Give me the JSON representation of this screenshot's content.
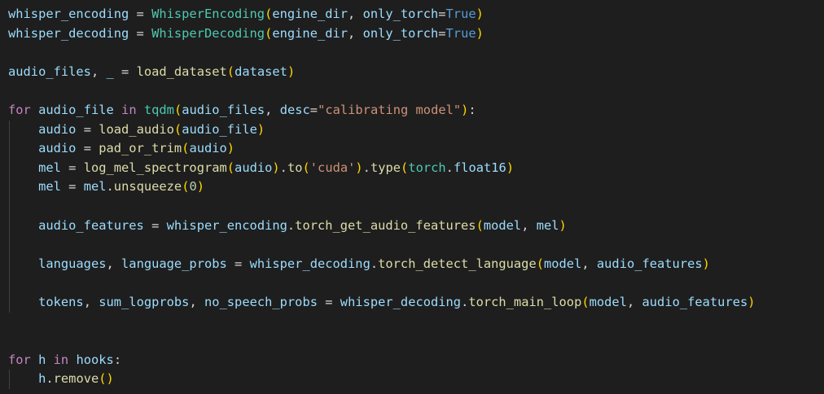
{
  "editor": {
    "colors": {
      "background": "#1e1e1e",
      "variable": "#9cdcfe",
      "function": "#dcdcaa",
      "class": "#4ec9b0",
      "keyword": "#c586c0",
      "string": "#ce9178",
      "number": "#b5cea8",
      "constant": "#569cd6",
      "punctuation": "#d4d4d4",
      "bracket_1": "#ffd700",
      "bracket_2": "#da70d6"
    },
    "lines": [
      {
        "indent": 0,
        "tokens": [
          {
            "t": "whisper_encoding",
            "c": "variable"
          },
          {
            "t": " = ",
            "c": "punctuation"
          },
          {
            "t": "WhisperEncoding",
            "c": "class"
          },
          {
            "t": "(",
            "c": "bracket_1"
          },
          {
            "t": "engine_dir",
            "c": "variable"
          },
          {
            "t": ", ",
            "c": "punctuation"
          },
          {
            "t": "only_torch",
            "c": "variable"
          },
          {
            "t": "=",
            "c": "punctuation"
          },
          {
            "t": "True",
            "c": "constant"
          },
          {
            "t": ")",
            "c": "bracket_1"
          }
        ]
      },
      {
        "indent": 0,
        "tokens": [
          {
            "t": "whisper_decoding",
            "c": "variable"
          },
          {
            "t": " = ",
            "c": "punctuation"
          },
          {
            "t": "WhisperDecoding",
            "c": "class"
          },
          {
            "t": "(",
            "c": "bracket_1"
          },
          {
            "t": "engine_dir",
            "c": "variable"
          },
          {
            "t": ", ",
            "c": "punctuation"
          },
          {
            "t": "only_torch",
            "c": "variable"
          },
          {
            "t": "=",
            "c": "punctuation"
          },
          {
            "t": "True",
            "c": "constant"
          },
          {
            "t": ")",
            "c": "bracket_1"
          }
        ]
      },
      {
        "indent": 0,
        "tokens": []
      },
      {
        "indent": 0,
        "tokens": [
          {
            "t": "audio_files",
            "c": "variable"
          },
          {
            "t": ", ",
            "c": "punctuation"
          },
          {
            "t": "_",
            "c": "variable"
          },
          {
            "t": " = ",
            "c": "punctuation"
          },
          {
            "t": "load_dataset",
            "c": "function"
          },
          {
            "t": "(",
            "c": "bracket_1"
          },
          {
            "t": "dataset",
            "c": "variable"
          },
          {
            "t": ")",
            "c": "bracket_1"
          }
        ]
      },
      {
        "indent": 0,
        "tokens": []
      },
      {
        "indent": 0,
        "tokens": [
          {
            "t": "for",
            "c": "keyword"
          },
          {
            "t": " ",
            "c": "punctuation"
          },
          {
            "t": "audio_file",
            "c": "variable"
          },
          {
            "t": " ",
            "c": "punctuation"
          },
          {
            "t": "in",
            "c": "keyword"
          },
          {
            "t": " ",
            "c": "punctuation"
          },
          {
            "t": "tqdm",
            "c": "class"
          },
          {
            "t": "(",
            "c": "bracket_1"
          },
          {
            "t": "audio_files",
            "c": "variable"
          },
          {
            "t": ", ",
            "c": "punctuation"
          },
          {
            "t": "desc",
            "c": "variable"
          },
          {
            "t": "=",
            "c": "punctuation"
          },
          {
            "t": "\"calibrating model\"",
            "c": "string"
          },
          {
            "t": ")",
            "c": "bracket_1"
          },
          {
            "t": ":",
            "c": "punctuation"
          }
        ]
      },
      {
        "indent": 1,
        "tokens": [
          {
            "t": "audio",
            "c": "variable"
          },
          {
            "t": " = ",
            "c": "punctuation"
          },
          {
            "t": "load_audio",
            "c": "function"
          },
          {
            "t": "(",
            "c": "bracket_1"
          },
          {
            "t": "audio_file",
            "c": "variable"
          },
          {
            "t": ")",
            "c": "bracket_1"
          }
        ]
      },
      {
        "indent": 1,
        "tokens": [
          {
            "t": "audio",
            "c": "variable"
          },
          {
            "t": " = ",
            "c": "punctuation"
          },
          {
            "t": "pad_or_trim",
            "c": "function"
          },
          {
            "t": "(",
            "c": "bracket_1"
          },
          {
            "t": "audio",
            "c": "variable"
          },
          {
            "t": ")",
            "c": "bracket_1"
          }
        ]
      },
      {
        "indent": 1,
        "tokens": [
          {
            "t": "mel",
            "c": "variable"
          },
          {
            "t": " = ",
            "c": "punctuation"
          },
          {
            "t": "log_mel_spectrogram",
            "c": "function"
          },
          {
            "t": "(",
            "c": "bracket_1"
          },
          {
            "t": "audio",
            "c": "variable"
          },
          {
            "t": ")",
            "c": "bracket_1"
          },
          {
            "t": ".",
            "c": "punctuation"
          },
          {
            "t": "to",
            "c": "function"
          },
          {
            "t": "(",
            "c": "bracket_1"
          },
          {
            "t": "'cuda'",
            "c": "string"
          },
          {
            "t": ")",
            "c": "bracket_1"
          },
          {
            "t": ".",
            "c": "punctuation"
          },
          {
            "t": "type",
            "c": "function"
          },
          {
            "t": "(",
            "c": "bracket_1"
          },
          {
            "t": "torch",
            "c": "class"
          },
          {
            "t": ".",
            "c": "punctuation"
          },
          {
            "t": "float16",
            "c": "variable"
          },
          {
            "t": ")",
            "c": "bracket_1"
          }
        ]
      },
      {
        "indent": 1,
        "tokens": [
          {
            "t": "mel",
            "c": "variable"
          },
          {
            "t": " = ",
            "c": "punctuation"
          },
          {
            "t": "mel",
            "c": "variable"
          },
          {
            "t": ".",
            "c": "punctuation"
          },
          {
            "t": "unsqueeze",
            "c": "function"
          },
          {
            "t": "(",
            "c": "bracket_1"
          },
          {
            "t": "0",
            "c": "number"
          },
          {
            "t": ")",
            "c": "bracket_1"
          }
        ]
      },
      {
        "indent": 1,
        "tokens": []
      },
      {
        "indent": 1,
        "tokens": [
          {
            "t": "audio_features",
            "c": "variable"
          },
          {
            "t": " = ",
            "c": "punctuation"
          },
          {
            "t": "whisper_encoding",
            "c": "variable"
          },
          {
            "t": ".",
            "c": "punctuation"
          },
          {
            "t": "torch_get_audio_features",
            "c": "function"
          },
          {
            "t": "(",
            "c": "bracket_1"
          },
          {
            "t": "model",
            "c": "variable"
          },
          {
            "t": ", ",
            "c": "punctuation"
          },
          {
            "t": "mel",
            "c": "variable"
          },
          {
            "t": ")",
            "c": "bracket_1"
          }
        ]
      },
      {
        "indent": 1,
        "tokens": []
      },
      {
        "indent": 1,
        "tokens": [
          {
            "t": "languages",
            "c": "variable"
          },
          {
            "t": ", ",
            "c": "punctuation"
          },
          {
            "t": "language_probs",
            "c": "variable"
          },
          {
            "t": " = ",
            "c": "punctuation"
          },
          {
            "t": "whisper_decoding",
            "c": "variable"
          },
          {
            "t": ".",
            "c": "punctuation"
          },
          {
            "t": "torch_detect_language",
            "c": "function"
          },
          {
            "t": "(",
            "c": "bracket_1"
          },
          {
            "t": "model",
            "c": "variable"
          },
          {
            "t": ", ",
            "c": "punctuation"
          },
          {
            "t": "audio_features",
            "c": "variable"
          },
          {
            "t": ")",
            "c": "bracket_1"
          }
        ]
      },
      {
        "indent": 1,
        "tokens": []
      },
      {
        "indent": 1,
        "tokens": [
          {
            "t": "tokens",
            "c": "variable"
          },
          {
            "t": ", ",
            "c": "punctuation"
          },
          {
            "t": "sum_logprobs",
            "c": "variable"
          },
          {
            "t": ", ",
            "c": "punctuation"
          },
          {
            "t": "no_speech_probs",
            "c": "variable"
          },
          {
            "t": " = ",
            "c": "punctuation"
          },
          {
            "t": "whisper_decoding",
            "c": "variable"
          },
          {
            "t": ".",
            "c": "punctuation"
          },
          {
            "t": "torch_main_loop",
            "c": "function"
          },
          {
            "t": "(",
            "c": "bracket_1"
          },
          {
            "t": "model",
            "c": "variable"
          },
          {
            "t": ", ",
            "c": "punctuation"
          },
          {
            "t": "audio_features",
            "c": "variable"
          },
          {
            "t": ")",
            "c": "bracket_1"
          }
        ]
      },
      {
        "indent": 0,
        "tokens": []
      },
      {
        "indent": 0,
        "tokens": []
      },
      {
        "indent": 0,
        "tokens": [
          {
            "t": "for",
            "c": "keyword"
          },
          {
            "t": " ",
            "c": "punctuation"
          },
          {
            "t": "h",
            "c": "variable"
          },
          {
            "t": " ",
            "c": "punctuation"
          },
          {
            "t": "in",
            "c": "keyword"
          },
          {
            "t": " ",
            "c": "punctuation"
          },
          {
            "t": "hooks",
            "c": "variable"
          },
          {
            "t": ":",
            "c": "punctuation"
          }
        ]
      },
      {
        "indent": 1,
        "tokens": [
          {
            "t": "h",
            "c": "variable"
          },
          {
            "t": ".",
            "c": "punctuation"
          },
          {
            "t": "remove",
            "c": "function"
          },
          {
            "t": "(",
            "c": "bracket_1"
          },
          {
            "t": ")",
            "c": "bracket_1"
          }
        ]
      }
    ]
  }
}
